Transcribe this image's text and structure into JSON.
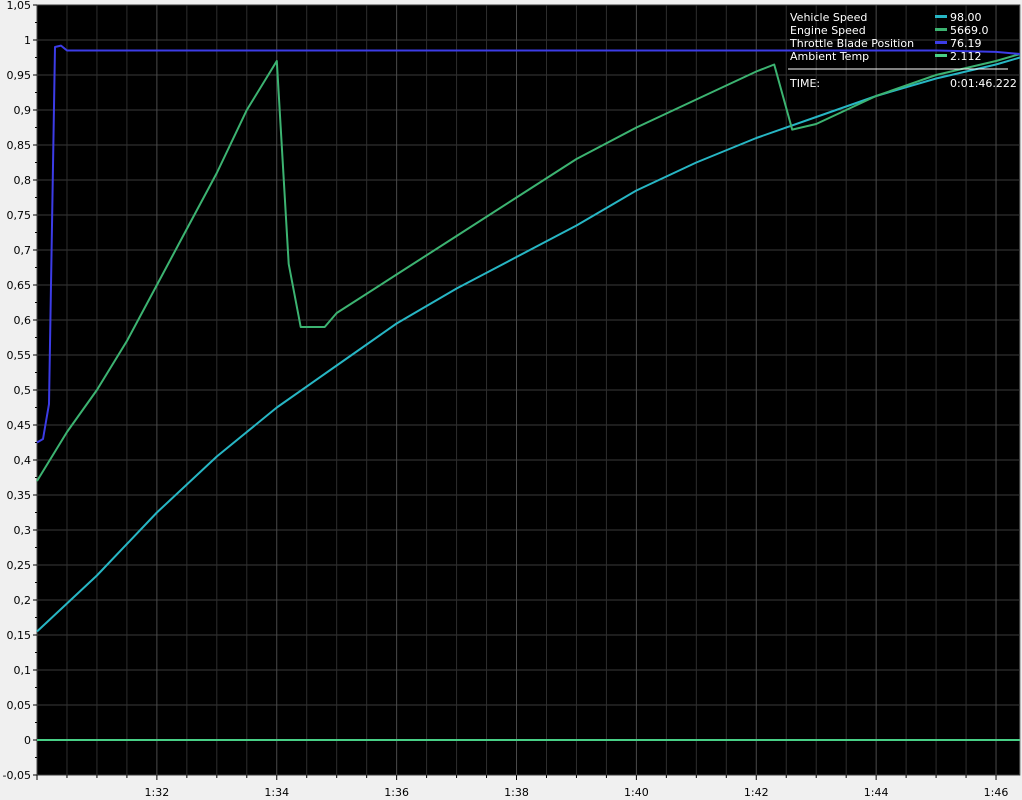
{
  "chart_data": {
    "type": "line",
    "background": "#000000",
    "grid": true,
    "legend_position": "top-right",
    "ylim": [
      -0.05,
      1.05
    ],
    "y_ticks": [
      "-0,05",
      "0",
      "0,05",
      "0,1",
      "0,15",
      "0,2",
      "0,25",
      "0,3",
      "0,35",
      "0,4",
      "0,45",
      "0,5",
      "0,55",
      "0,6",
      "0,65",
      "0,7",
      "0,75",
      "0,8",
      "0,85",
      "0,9",
      "0,95",
      "1",
      "1,05"
    ],
    "xlim": [
      "1:30.0",
      "1:46.4"
    ],
    "x_ticks": [
      "1:32",
      "1:34",
      "1:36",
      "1:38",
      "1:40",
      "1:42",
      "1:44",
      "1:46"
    ],
    "series": [
      {
        "name": "Vehicle Speed",
        "readout": "98.00",
        "color": "#27b6c4",
        "x": [
          "1:30.0",
          "1:31.0",
          "1:32.0",
          "1:33.0",
          "1:34.0",
          "1:35.0",
          "1:36.0",
          "1:37.0",
          "1:38.0",
          "1:39.0",
          "1:40.0",
          "1:41.0",
          "1:42.0",
          "1:43.0",
          "1:44.0",
          "1:45.0",
          "1:46.0",
          "1:46.4"
        ],
        "y": [
          0.155,
          0.235,
          0.325,
          0.405,
          0.475,
          0.535,
          0.595,
          0.645,
          0.69,
          0.735,
          0.785,
          0.825,
          0.86,
          0.89,
          0.92,
          0.945,
          0.965,
          0.975
        ]
      },
      {
        "name": "Engine Speed",
        "readout": "5669.0",
        "color": "#3cb371",
        "x": [
          "1:30.0",
          "1:30.5",
          "1:31.0",
          "1:31.5",
          "1:32.0",
          "1:32.5",
          "1:33.0",
          "1:33.5",
          "1:34.0",
          "1:34.2",
          "1:34.4",
          "1:34.8",
          "1:35.0",
          "1:36.0",
          "1:37.0",
          "1:38.0",
          "1:39.0",
          "1:40.0",
          "1:41.0",
          "1:42.0",
          "1:42.3",
          "1:42.6",
          "1:43.0",
          "1:44.0",
          "1:45.0",
          "1:46.0",
          "1:46.4"
        ],
        "y": [
          0.37,
          0.44,
          0.5,
          0.57,
          0.65,
          0.73,
          0.81,
          0.9,
          0.97,
          0.68,
          0.59,
          0.59,
          0.61,
          0.665,
          0.72,
          0.775,
          0.83,
          0.875,
          0.915,
          0.955,
          0.965,
          0.872,
          0.88,
          0.92,
          0.95,
          0.97,
          0.98
        ]
      },
      {
        "name": "Throttle Blade Position",
        "readout": "76.19",
        "color": "#3c3ce6",
        "x": [
          "1:30.0",
          "1:30.1",
          "1:30.2",
          "1:30.3",
          "1:30.4",
          "1:30.5",
          "1:30.6",
          "1:31.0",
          "1:42.0",
          "1:45.0",
          "1:46.0",
          "1:46.4"
        ],
        "y": [
          0.425,
          0.43,
          0.48,
          0.99,
          0.992,
          0.985,
          0.985,
          0.985,
          0.985,
          0.985,
          0.983,
          0.98
        ]
      },
      {
        "name": "Ambient Temp",
        "readout": "2.112",
        "color": "#48d086",
        "x": [
          "1:30.0",
          "1:46.4"
        ],
        "y": [
          0.0,
          0.0
        ]
      }
    ],
    "time_label": "TIME:",
    "time_value": "0:01:46.222"
  }
}
